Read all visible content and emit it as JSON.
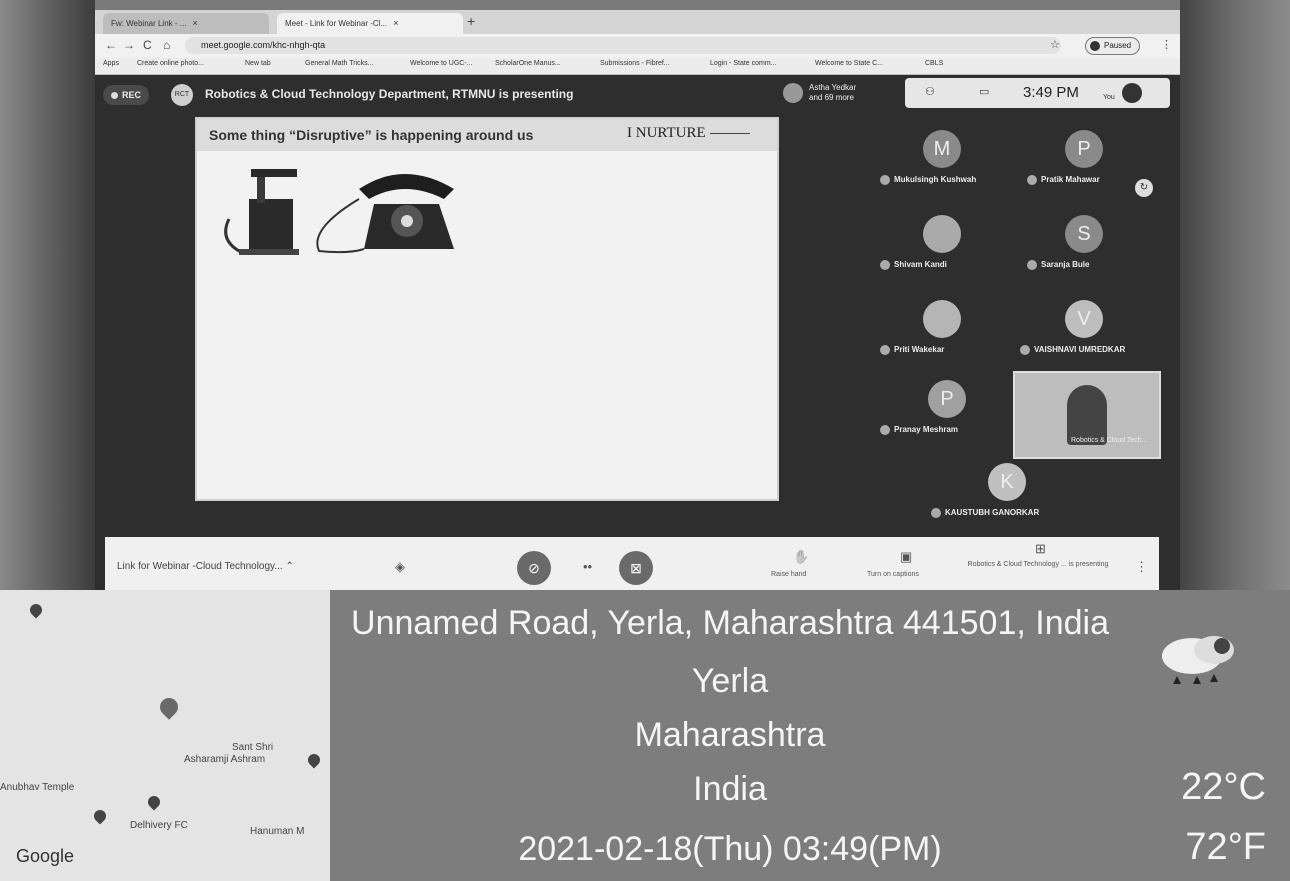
{
  "browser": {
    "tabs": [
      {
        "label": "Fw: Webinar Link - ..."
      },
      {
        "label": "Meet - Link for Webinar -Cl..."
      }
    ],
    "url": "meet.google.com/khc-nhgh-qta",
    "paused_label": "Paused",
    "bookmarks": [
      "Apps",
      "Create online photo...",
      "New tab",
      "General Math Tricks...",
      "Welcome to UGC-...",
      "ScholarOne Manus...",
      "Submissions - Fibref...",
      "Login - State comm...",
      "Welcome to State C...",
      "CBLS"
    ]
  },
  "meet": {
    "rec_label": "REC",
    "presenter_initials": "RCT",
    "presenting_text": "Robotics & Cloud Technology Department, RTMNU is presenting",
    "participants_chip": [
      "Astha Yedkar",
      "and 69 more"
    ],
    "time": "3:49 PM",
    "you_label": "You",
    "slide": {
      "title": "Some thing “Disruptive” is happening around us",
      "logo": "I NURTURE"
    },
    "participants": [
      {
        "initial": "M",
        "name": "Mukulsingh Kushwah"
      },
      {
        "initial": "P",
        "name": "Pratik Mahawar"
      },
      {
        "initial": "",
        "name": "Shivam Kandi"
      },
      {
        "initial": "S",
        "name": "Saranja Bule"
      },
      {
        "initial": "",
        "name": "Priti Wakekar"
      },
      {
        "initial": "V",
        "name": "VAISHNAVI UMREDKAR"
      },
      {
        "initial": "P",
        "name": "Pranay Meshram"
      },
      {
        "initial": "K",
        "name": "KAUSTUBH GANORKAR"
      }
    ],
    "video_caption": "Robotics & Cloud Tech...",
    "controls": {
      "meeting_name": "Link for Webinar -Cloud Technology...",
      "raise_hand": "Raise hand",
      "turn_on_captions": "Turn on captions",
      "presenting_label": "Robotics & Cloud Technology ... is presenting"
    }
  },
  "map": {
    "labels": [
      "Sant Shri",
      "Asharamji Ashram",
      "Anubhav Temple",
      "Delhivery FC",
      "Hanuman M",
      "Google"
    ]
  },
  "overlay": {
    "address": "Unnamed Road, Yerla, Maharashtra 441501, India",
    "city": "Yerla",
    "state": "Maharashtra",
    "country": "India",
    "datetime": "2021-02-18(Thu)   03:49(PM)",
    "temp_c": "22°C",
    "temp_f": "72°F"
  }
}
